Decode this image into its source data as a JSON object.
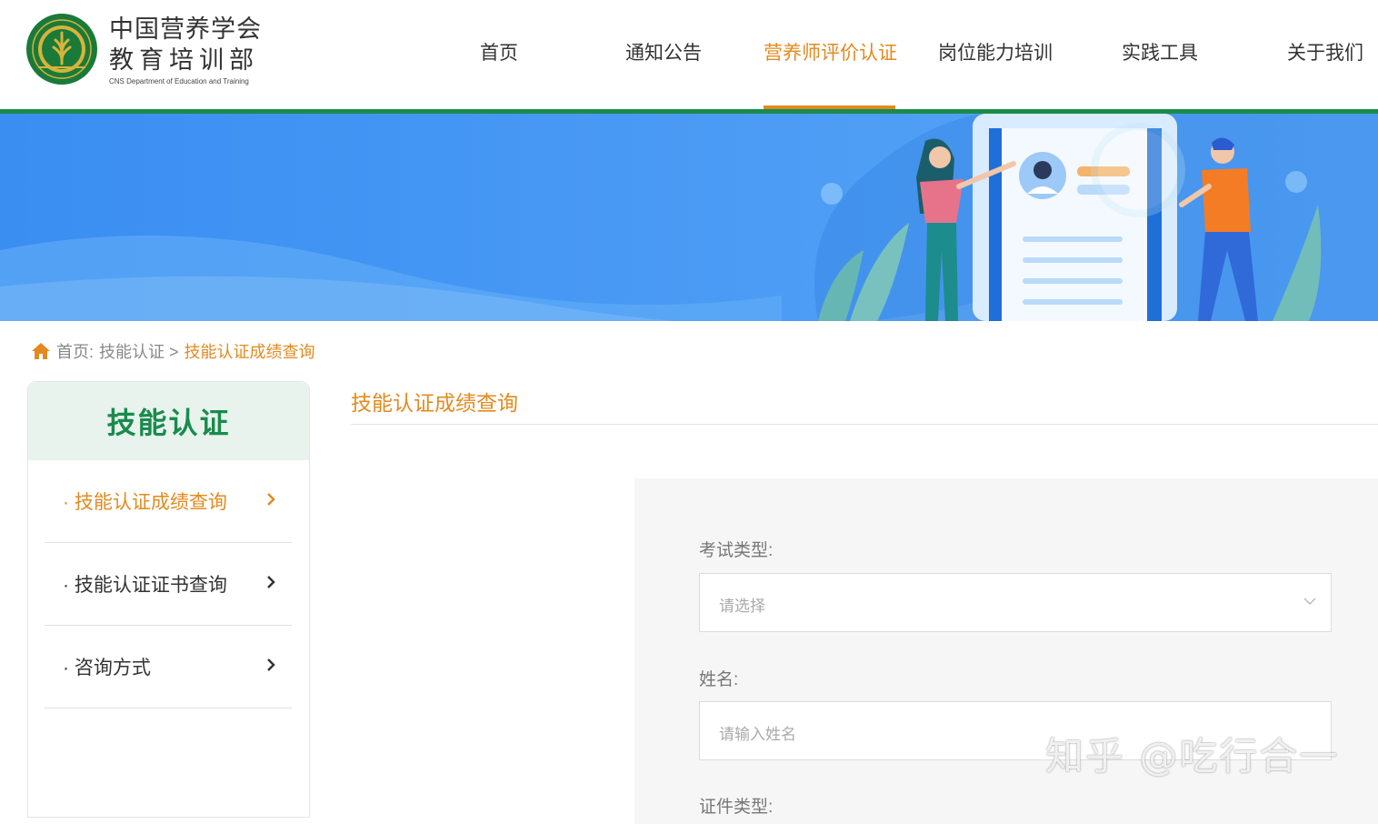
{
  "brand": {
    "title_line1": "中国营养学会",
    "title_line2": "教育培训部",
    "subtitle_en": "CNS Department of Education and Training",
    "logo_text_top": "中国营养学会",
    "logo_text_bottom": "C·N·S"
  },
  "nav": {
    "items": [
      {
        "label": "首页"
      },
      {
        "label": "通知公告"
      },
      {
        "label": "营养师评价认证",
        "active": true
      },
      {
        "label": "岗位能力培训"
      },
      {
        "label": "实践工具"
      },
      {
        "label": "关于我们"
      }
    ]
  },
  "breadcrumb": {
    "home": "首页:",
    "parent": "技能认证 >",
    "current": "技能认证成绩查询"
  },
  "sidebar": {
    "title": "技能认证",
    "items": [
      {
        "label": "· 技能认证成绩查询",
        "active": true
      },
      {
        "label": "· 技能认证证书查询"
      },
      {
        "label": "· 咨询方式"
      }
    ]
  },
  "main": {
    "title": "技能认证成绩查询",
    "form": {
      "exam_type_label": "考试类型:",
      "exam_type_placeholder": "请选择",
      "name_label": "姓名:",
      "name_placeholder": "请输入姓名",
      "id_type_label": "证件类型:"
    }
  },
  "watermark": "知乎 @吃行合一",
  "colors": {
    "accent": "#e38a1f",
    "brand_green": "#1a8b4c",
    "banner_blue": "#3b8ff0"
  }
}
